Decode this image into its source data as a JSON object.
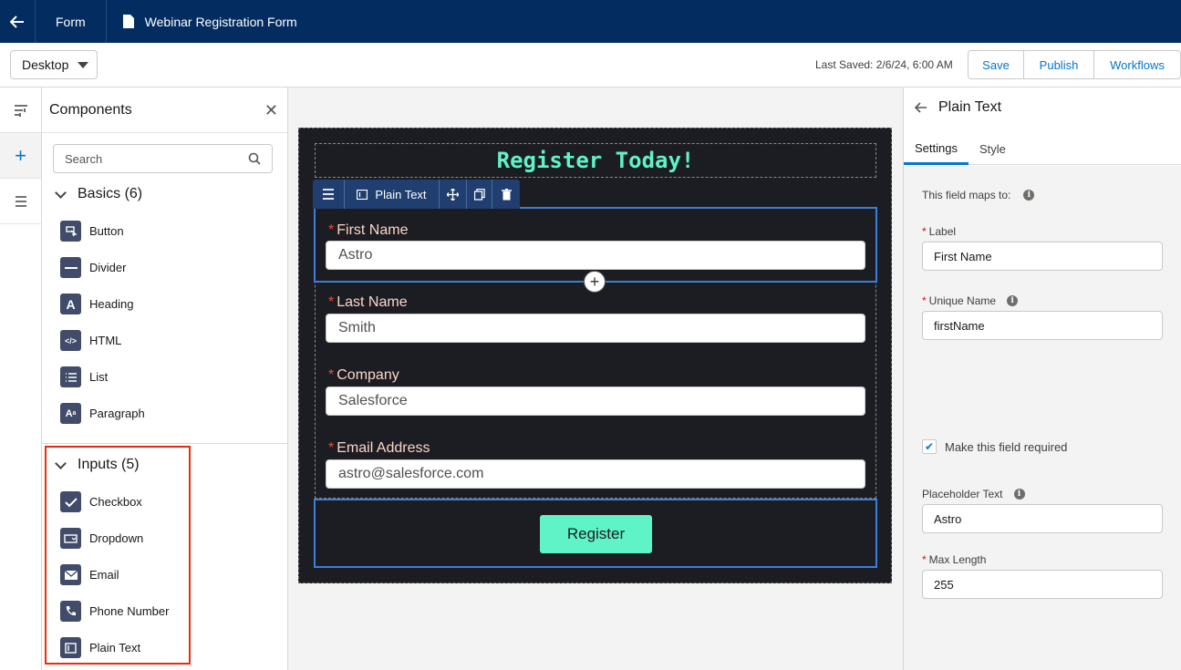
{
  "topbar": {
    "section": "Form",
    "document_title": "Webinar Registration Form"
  },
  "toolbar": {
    "view": "Desktop",
    "last_saved": "Last Saved: 2/6/24, 6:00 AM",
    "save": "Save",
    "publish": "Publish",
    "workflows": "Workflows"
  },
  "components": {
    "title": "Components",
    "search_placeholder": "Search",
    "basics": {
      "title": "Basics (6)",
      "items": [
        "Button",
        "Divider",
        "Heading",
        "HTML",
        "List",
        "Paragraph"
      ]
    },
    "inputs": {
      "title": "Inputs (5)",
      "items": [
        "Checkbox",
        "Dropdown",
        "Email",
        "Phone Number",
        "Plain Text"
      ]
    }
  },
  "canvas": {
    "heading": "Register Today!",
    "toolbar_label": "Plain Text",
    "fields": [
      {
        "label": "First Name",
        "value": "Astro"
      },
      {
        "label": "Last Name",
        "value": "Smith"
      },
      {
        "label": "Company",
        "value": "Salesforce"
      },
      {
        "label": "Email Address",
        "value": "astro@salesforce.com"
      }
    ],
    "required_mark": "*",
    "register": "Register"
  },
  "props": {
    "title": "Plain Text",
    "tabs": [
      "Settings",
      "Style"
    ],
    "maps_to": "This field maps to:",
    "label_label": "Label",
    "label_value": "First Name",
    "unique_name_label": "Unique Name",
    "unique_name_value": "firstName",
    "required_checkbox": "Make this field required",
    "required_checked": true,
    "placeholder_label": "Placeholder Text",
    "placeholder_value": "Astro",
    "max_length_label": "Max Length",
    "max_length_value": "255"
  },
  "colors": {
    "topbar": "#032d60",
    "accent": "#0176d3",
    "form_bg": "#1c1d22",
    "heading": "#5ff3c7",
    "highlight": "#ea2a12"
  }
}
